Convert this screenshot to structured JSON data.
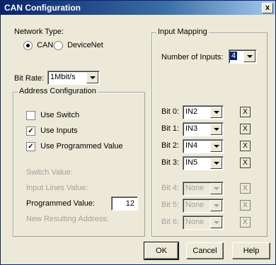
{
  "window": {
    "title": "CAN Configuration",
    "close": "x"
  },
  "network": {
    "label": "Network Type:",
    "options": [
      {
        "label": "CAN",
        "selected": true
      },
      {
        "label": "DeviceNet",
        "selected": false
      }
    ]
  },
  "bit_rate": {
    "label": "Bit Rate:",
    "value": "1Mbit/s"
  },
  "address": {
    "title": "Address Configuration",
    "use_switch": {
      "label": "Use Switch",
      "checked": false
    },
    "use_inputs": {
      "label": "Use Inputs",
      "checked": true
    },
    "use_programmed": {
      "label": "Use Programmed Value",
      "checked": true
    },
    "switch_value_label": "Switch Value:",
    "input_lines_label": "Input Lines Value:",
    "programmed_value_label": "Programmed Value:",
    "programmed_value": "12",
    "new_address_label": "New Resulting Address:"
  },
  "input_mapping": {
    "title": "Input Mapping",
    "num_inputs_label": "Number of Inputs:",
    "num_inputs": "4",
    "bits": [
      {
        "label": "Bit 0:",
        "value": "IN2",
        "enabled": true,
        "x": "X"
      },
      {
        "label": "Bit 1:",
        "value": "IN3",
        "enabled": true,
        "x": "X"
      },
      {
        "label": "Bit 2:",
        "value": "IN4",
        "enabled": true,
        "x": "X"
      },
      {
        "label": "Bit 3:",
        "value": "IN5",
        "enabled": true,
        "x": "X"
      },
      {
        "label": "Bit 4:",
        "value": "None",
        "enabled": false,
        "x": "X"
      },
      {
        "label": "Bit 5:",
        "value": "None",
        "enabled": false,
        "x": "X"
      },
      {
        "label": "Bit 6:",
        "value": "None",
        "enabled": false,
        "x": "X"
      }
    ]
  },
  "buttons": {
    "ok": "OK",
    "cancel": "Cancel",
    "help": "Help"
  }
}
